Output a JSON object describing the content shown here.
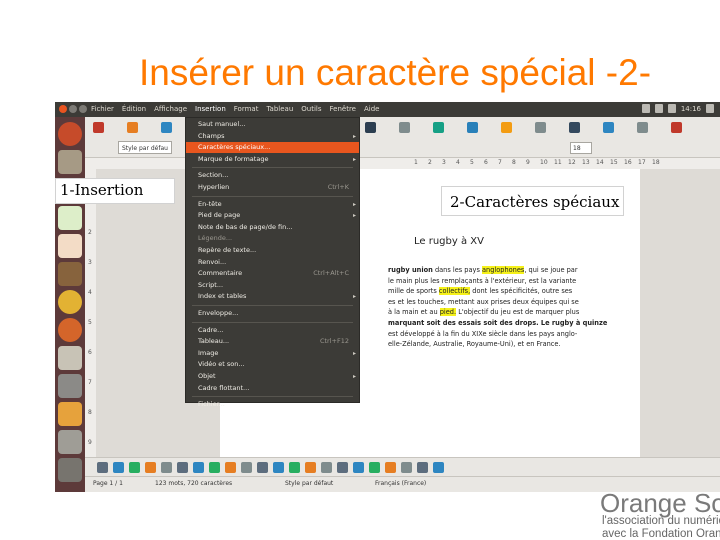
{
  "slide": {
    "title": "Insérer un caractère spécial -2-"
  },
  "callouts": {
    "step1": "1-Insertion",
    "step2": "2-Caractères spéciaux"
  },
  "menubar": {
    "items": [
      "Fichier",
      "Édition",
      "Affichage",
      "Insertion",
      "Format",
      "Tableau",
      "Outils",
      "Fenêtre",
      "Aide"
    ],
    "active": "Insertion",
    "clock": "14:16"
  },
  "toolbar": {
    "paragraph_style": "Style par défau",
    "font_size": "18"
  },
  "insert_menu": {
    "items": [
      {
        "label": "Saut manuel...",
        "shortcut": "",
        "submenu": false,
        "disabled": false
      },
      {
        "label": "Champs",
        "shortcut": "",
        "submenu": true,
        "disabled": false
      },
      {
        "label": "Caractères spéciaux...",
        "shortcut": "",
        "submenu": false,
        "disabled": false,
        "highlight": true
      },
      {
        "label": "Marque de formatage",
        "shortcut": "",
        "submenu": true,
        "disabled": false
      },
      {
        "label": "Section...",
        "shortcut": "",
        "submenu": false,
        "disabled": false,
        "sep_before": true
      },
      {
        "label": "Hyperlien",
        "shortcut": "Ctrl+K",
        "submenu": false,
        "disabled": false
      },
      {
        "label": "En-tête",
        "shortcut": "",
        "submenu": true,
        "disabled": false,
        "sep_before": true
      },
      {
        "label": "Pied de page",
        "shortcut": "",
        "submenu": true,
        "disabled": false
      },
      {
        "label": "Note de bas de page/de fin...",
        "shortcut": "",
        "submenu": false,
        "disabled": false
      },
      {
        "label": "Légende...",
        "shortcut": "",
        "submenu": false,
        "disabled": true
      },
      {
        "label": "Repère de texte...",
        "shortcut": "",
        "submenu": false,
        "disabled": false
      },
      {
        "label": "Renvoi...",
        "shortcut": "",
        "submenu": false,
        "disabled": false
      },
      {
        "label": "Commentaire",
        "shortcut": "Ctrl+Alt+C",
        "submenu": false,
        "disabled": false
      },
      {
        "label": "Script...",
        "shortcut": "",
        "submenu": false,
        "disabled": false
      },
      {
        "label": "Index et tables",
        "shortcut": "",
        "submenu": true,
        "disabled": false
      },
      {
        "label": "Enveloppe...",
        "shortcut": "",
        "submenu": false,
        "disabled": false,
        "sep_before": true
      },
      {
        "label": "Cadre...",
        "shortcut": "",
        "submenu": false,
        "disabled": false,
        "sep_before": true
      },
      {
        "label": "Tableau...",
        "shortcut": "Ctrl+F12",
        "submenu": false,
        "disabled": false
      },
      {
        "label": "Image",
        "shortcut": "",
        "submenu": true,
        "disabled": false
      },
      {
        "label": "Vidéo et son...",
        "shortcut": "",
        "submenu": false,
        "disabled": false
      },
      {
        "label": "Objet",
        "shortcut": "",
        "submenu": true,
        "disabled": false
      },
      {
        "label": "Cadre flottant...",
        "shortcut": "",
        "submenu": false,
        "disabled": false
      },
      {
        "label": "Fichier...",
        "shortcut": "",
        "submenu": false,
        "disabled": false,
        "sep_before": true
      }
    ]
  },
  "document": {
    "title": "Le rugby à XV",
    "lines": [
      [
        {
          "t": "rugby union",
          "b": true
        },
        {
          "t": " dans les pays "
        },
        {
          "t": "anglophones",
          "h": true
        },
        {
          "t": ", qui se joue par"
        }
      ],
      [
        {
          "t": "le main plus les remplaçants à l'extérieur, est la variante"
        }
      ],
      [
        {
          "t": "mille de sports "
        },
        {
          "t": "collectifs,",
          "h": true
        },
        {
          "t": " dont les spécificités, outre ses"
        }
      ],
      [
        {
          "t": "es et les touches, mettant aux prises deux équipes qui se"
        }
      ],
      [
        {
          "t": "à la main et au "
        },
        {
          "t": "pied.",
          "h": true
        },
        {
          "t": " L'objectif du jeu est de marquer plus"
        }
      ],
      [
        {
          "t": "marquant soit des essais soit des drops. Le rugby à quinze",
          "b": true
        }
      ],
      [
        {
          "t": "est développé à la fin du XIXe siècle dans les pays anglo-"
        }
      ],
      [
        {
          "t": "elle-Zélande, Australie, Royaume-Uni), et en France."
        }
      ]
    ]
  },
  "statusbar": {
    "page": "Page 1 / 1",
    "words": "123 mots, 720 caractères",
    "style": "Style par défaut",
    "language": "Français (France)"
  },
  "branding": {
    "name": "Orange Soli",
    "line1": "l'association du numériq",
    "line2": "avec la Fondation Orange"
  },
  "colors": {
    "title": "#ff7900",
    "menu_highlight": "#e8561e",
    "text_highlight": "#f5f11a"
  }
}
